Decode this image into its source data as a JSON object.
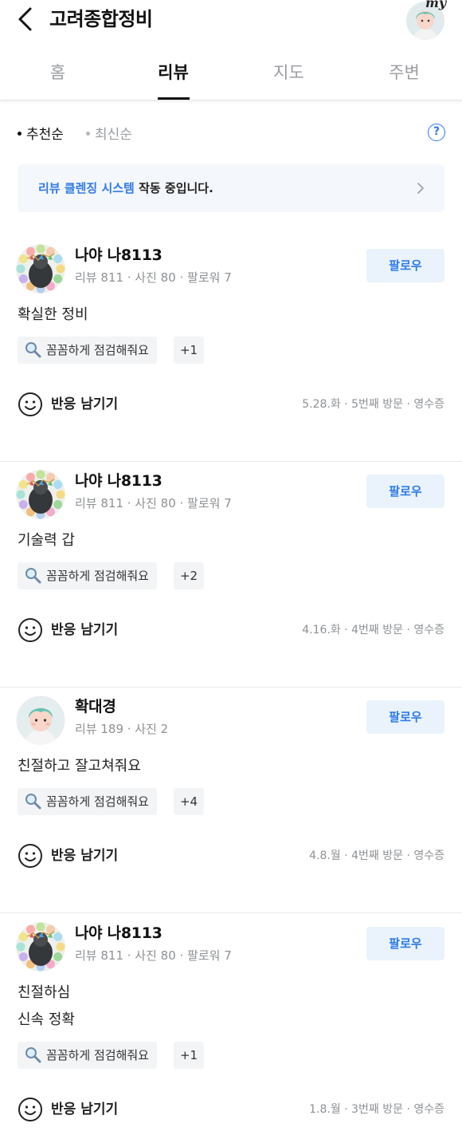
{
  "header": {
    "title": "고려종합정비",
    "my_label": "my"
  },
  "tabs": [
    "홈",
    "리뷰",
    "지도",
    "주변"
  ],
  "sort": {
    "recommended": "추천순",
    "latest": "최신순",
    "help": "?"
  },
  "notice": {
    "highlight": "리뷰 클렌징 시스템",
    "rest": " 작동 중입니다."
  },
  "reviews": [
    {
      "name": "나야 나8113",
      "stats": "리뷰 811 · 사진 80 · 팔로워 7",
      "follow": "팔로우",
      "lines": [
        "확실한 정비"
      ],
      "tag": "꼼꼼하게 점검해줘요",
      "tag_more": "+1",
      "react": "반응 남기기",
      "meta": "5.28.화 · 5번째 방문 · 영수증"
    },
    {
      "name": "나야 나8113",
      "stats": "리뷰 811 · 사진 80 · 팔로워 7",
      "follow": "팔로우",
      "lines": [
        "기술력 갑"
      ],
      "tag": "꼼꼼하게 점검해줘요",
      "tag_more": "+2",
      "react": "반응 남기기",
      "meta": "4.16.화 · 4번째 방문 · 영수증"
    },
    {
      "name": "확대경",
      "stats": "리뷰 189 · 사진 2",
      "follow": "팔로우",
      "lines": [
        "친절하고 잘고쳐줘요"
      ],
      "tag": "꼼꼼하게 점검해줘요",
      "tag_more": "+4",
      "react": "반응 남기기",
      "meta": "4.8.월 · 4번째 방문 · 영수증"
    },
    {
      "name": "나야 나8113",
      "stats": "리뷰 811 · 사진 80 · 팔로워 7",
      "follow": "팔로우",
      "lines": [
        "친절하심",
        "신속 정확"
      ],
      "tag": "꼼꼼하게 점검해줘요",
      "tag_more": "+1",
      "react": "반응 남기기",
      "meta": "1.8.월 · 3번째 방문 · 영수증"
    }
  ],
  "colors": {
    "accent": "#2f7be8",
    "follow_bg": "#eaf3fc",
    "notice_bg": "#f4f7fb"
  },
  "icons": [
    "back-arrow-icon",
    "my-avatar",
    "help-icon",
    "chevron-right-icon",
    "magnifier-icon",
    "smiley-icon"
  ]
}
